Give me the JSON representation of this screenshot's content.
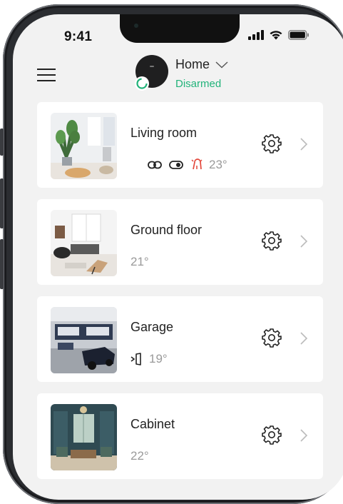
{
  "status_bar": {
    "time": "9:41",
    "icons": [
      "signal-icon",
      "wifi-icon",
      "battery-icon"
    ]
  },
  "header": {
    "menu_icon": "hamburger-menu-icon",
    "hub_name": "Home",
    "hub_state": "Disarmed",
    "hub_state_color": "#22b37a",
    "dropdown_icon": "chevron-down-icon"
  },
  "rooms": [
    {
      "name": "Living room",
      "temperature": "23°",
      "status_icons": [
        "link-icon",
        "toggle-icon",
        "siren-icon"
      ]
    },
    {
      "name": "Ground floor",
      "temperature": "21°",
      "status_icons": []
    },
    {
      "name": "Garage",
      "temperature": "19°",
      "status_icons": [
        "door-open-icon"
      ]
    },
    {
      "name": "Cabinet",
      "temperature": "22°",
      "status_icons": []
    }
  ],
  "colors": {
    "background": "#f2f2f2",
    "card": "#ffffff",
    "accent_red": "#e3473b",
    "text_primary": "#222222",
    "text_secondary": "#9a9a9a"
  }
}
